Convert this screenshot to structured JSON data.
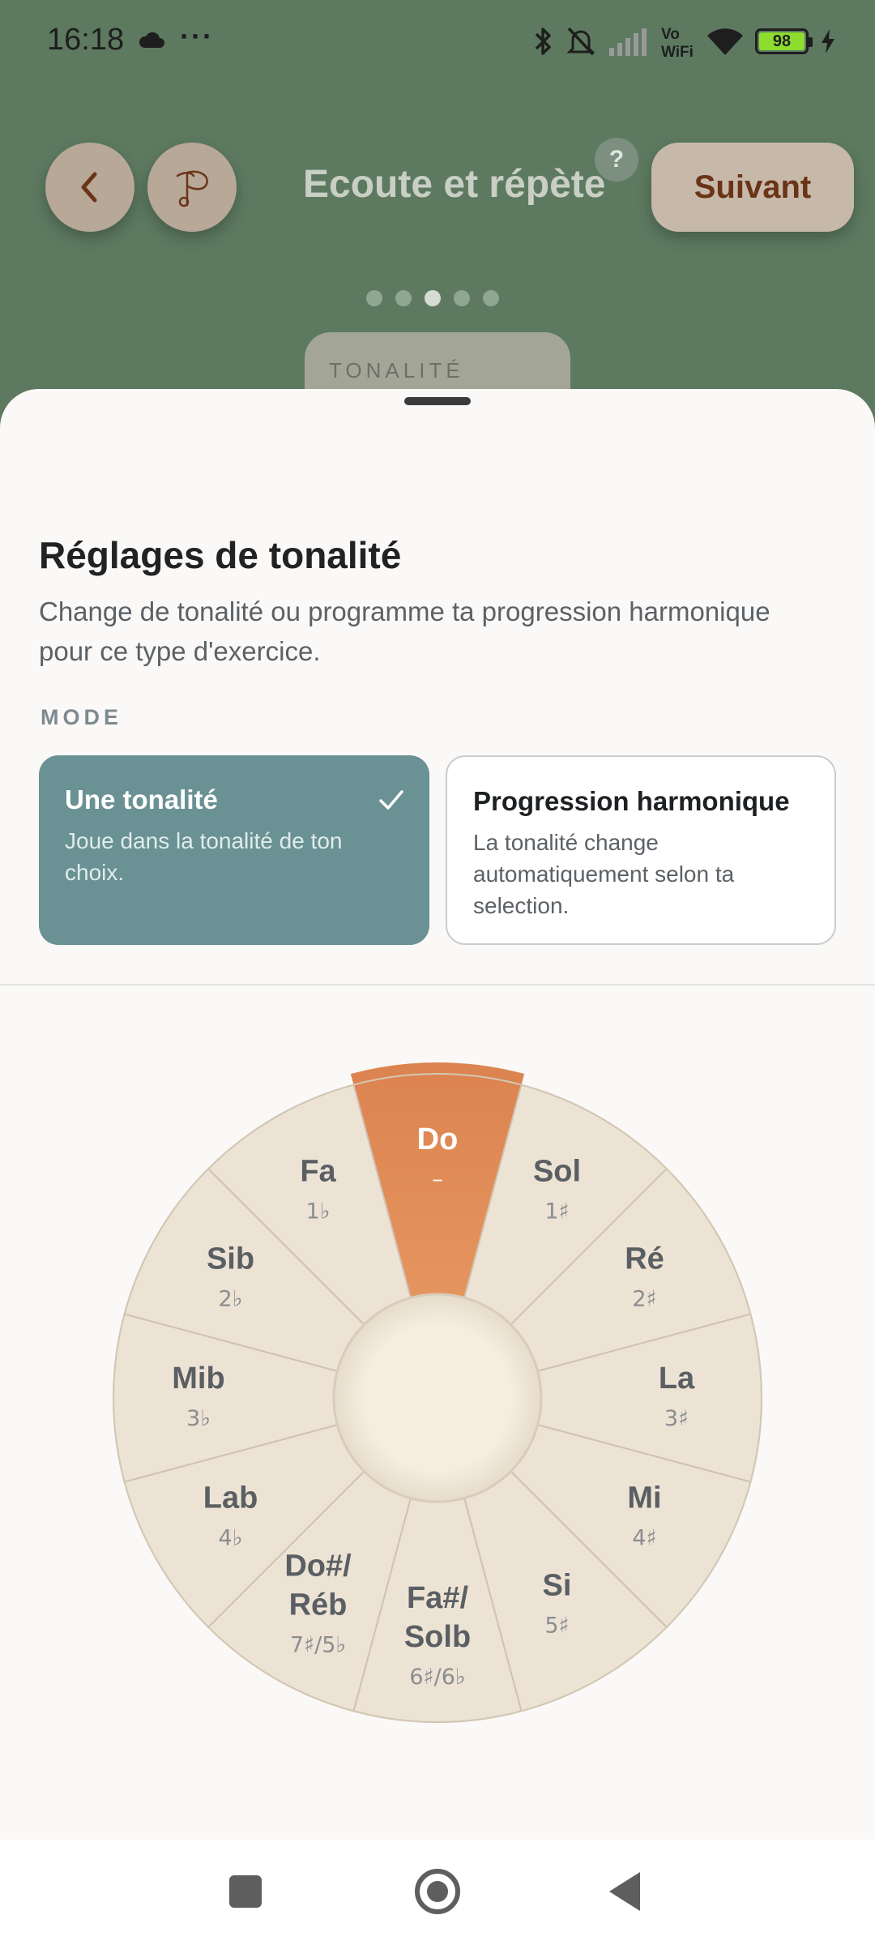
{
  "status_bar": {
    "time": "16:18",
    "more": "···",
    "battery": "98",
    "icons": [
      "cloud-icon",
      "bluetooth-icon",
      "mute-icon",
      "signal-icon",
      "vowifi-icon",
      "wifi-icon",
      "battery-icon",
      "charging-icon"
    ]
  },
  "header": {
    "title": "Ecoute et répète",
    "help": "?",
    "next_label": "Suivant",
    "pager": {
      "count": 5,
      "active_index": 2
    },
    "tonalite_chip": "TONALITÉ"
  },
  "sheet": {
    "title": "Réglages de tonalité",
    "description": "Change de tonalité ou programme ta progression harmonique pour ce type d'exercice.",
    "mode_label": "MODE",
    "modes": [
      {
        "title": "Une tonalité",
        "subtitle": "Joue dans la tonalité de ton choix.",
        "selected": true
      },
      {
        "title": "Progression harmonique",
        "subtitle": "La tonalité change automatiquement selon ta selection.",
        "selected": false
      }
    ]
  },
  "wheel": {
    "selected_index": 0,
    "colors": {
      "selected": "#dc8350",
      "segment": "#ede3d5",
      "line": "#cfc3b2",
      "label": "#5a5f63",
      "sub": "#8a8d90"
    },
    "keys": [
      {
        "name": "Do",
        "sig": "–"
      },
      {
        "name": "Sol",
        "sig": "1♯"
      },
      {
        "name": "Ré",
        "sig": "2♯"
      },
      {
        "name": "La",
        "sig": "3♯"
      },
      {
        "name": "Mi",
        "sig": "4♯"
      },
      {
        "name": "Si",
        "sig": "5♯"
      },
      {
        "name": "Fa#/\nSolb",
        "sig": "6♯/6♭"
      },
      {
        "name": "Do#/\nRéb",
        "sig": "7♯/5♭"
      },
      {
        "name": "Lab",
        "sig": "4♭"
      },
      {
        "name": "Mib",
        "sig": "3♭"
      },
      {
        "name": "Sib",
        "sig": "2♭"
      },
      {
        "name": "Fa",
        "sig": "1♭"
      }
    ]
  }
}
